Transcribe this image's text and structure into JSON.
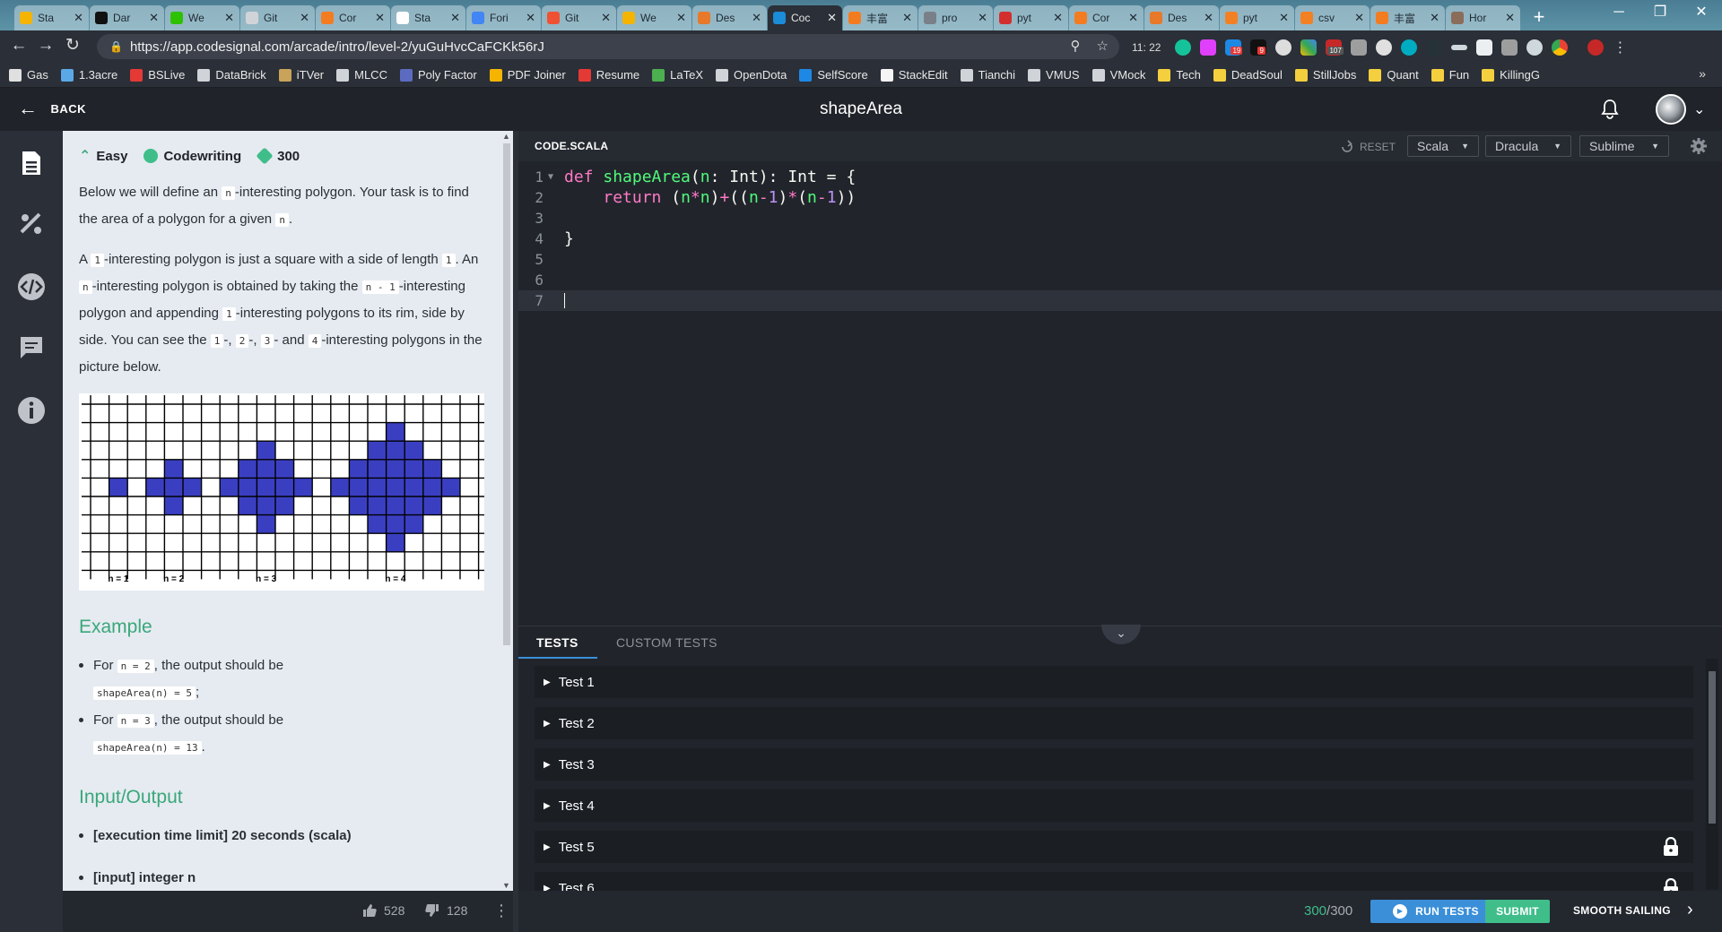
{
  "browser": {
    "tabs": [
      {
        "label": "Sta",
        "icon": "drive-icon",
        "color": "#f4b400",
        "active": false
      },
      {
        "label": "Dar",
        "icon": "github-icon",
        "color": "#111111",
        "active": false
      },
      {
        "label": "We",
        "icon": "wechat-icon",
        "color": "#2dc100",
        "active": false
      },
      {
        "label": "Git",
        "icon": "doc-icon",
        "color": "#d0d4d8",
        "active": false
      },
      {
        "label": "Cor",
        "icon": "orange-icon",
        "color": "#f47c20",
        "active": false
      },
      {
        "label": "Sta",
        "icon": "stack-icon",
        "color": "#ffffff",
        "active": false
      },
      {
        "label": "Fori",
        "icon": "google-icon",
        "color": "#4285f4",
        "active": false
      },
      {
        "label": "Git",
        "icon": "git-icon",
        "color": "#f05133",
        "active": false
      },
      {
        "label": "We",
        "icon": "drive-icon",
        "color": "#f4b400",
        "active": false
      },
      {
        "label": "Des",
        "icon": "bracket-icon",
        "color": "#e8782a",
        "active": false
      },
      {
        "label": "Coc",
        "icon": "codesignal-icon",
        "color": "#1a8cd8",
        "active": true
      },
      {
        "label": "丰富",
        "icon": "orange-icon",
        "color": "#f47c20",
        "active": false
      },
      {
        "label": "pro",
        "icon": "globe-icon",
        "color": "#7a8088",
        "active": false
      },
      {
        "label": "pyt",
        "icon": "c-icon",
        "color": "#d32f2f",
        "active": false
      },
      {
        "label": "Cor",
        "icon": "orange-icon",
        "color": "#f47c20",
        "active": false
      },
      {
        "label": "Des",
        "icon": "bracket-icon",
        "color": "#e8782a",
        "active": false
      },
      {
        "label": "pyt",
        "icon": "stack-icon",
        "color": "#f48024",
        "active": false
      },
      {
        "label": "csv",
        "icon": "stack-icon",
        "color": "#f48024",
        "active": false
      },
      {
        "label": "丰富",
        "icon": "orange-icon",
        "color": "#f47c20",
        "active": false
      },
      {
        "label": "Hor",
        "icon": "house-icon",
        "color": "#8a6d5b",
        "active": false
      }
    ],
    "address": {
      "url": "https://app.codesignal.com/arcade/intro/level-2/yuGuHvcCaFCKk56rJ",
      "time": "11: 22",
      "badges": {
        "b1": "19",
        "b2": "9",
        "b3": "107"
      }
    },
    "bookmarks": [
      {
        "label": "Gas",
        "color": "#e0e0e0"
      },
      {
        "label": "1.3acre",
        "color": "#5aa9e6"
      },
      {
        "label": "BSLive",
        "color": "#e53935"
      },
      {
        "label": "DataBrick",
        "color": "#d0d4d8"
      },
      {
        "label": "iTVer",
        "color": "#c9a35a"
      },
      {
        "label": "MLCC",
        "color": "#d0d4d8"
      },
      {
        "label": "Poly Factor",
        "color": "#5c6bc0"
      },
      {
        "label": "PDF Joiner",
        "color": "#f4b400"
      },
      {
        "label": "Resume",
        "color": "#e53935"
      },
      {
        "label": "LaTeX",
        "color": "#4caf50"
      },
      {
        "label": "OpenDota",
        "color": "#d0d4d8"
      },
      {
        "label": "SelfScore",
        "color": "#1e88e5"
      },
      {
        "label": "StackEdit",
        "color": "#f5f5f5"
      },
      {
        "label": "Tianchi",
        "color": "#d0d4d8"
      },
      {
        "label": "VMUS",
        "color": "#d0d4d8"
      },
      {
        "label": "VMock",
        "color": "#d0d4d8"
      },
      {
        "label": "Tech",
        "color": "#f4d03f"
      },
      {
        "label": "DeadSoul",
        "color": "#f4d03f"
      },
      {
        "label": "StillJobs",
        "color": "#f4d03f"
      },
      {
        "label": "Quant",
        "color": "#f4d03f"
      },
      {
        "label": "Fun",
        "color": "#f4d03f"
      },
      {
        "label": "KillingG",
        "color": "#f4d03f"
      }
    ],
    "more": "»"
  },
  "header": {
    "back_label": "BACK",
    "title": "shapeArea"
  },
  "description": {
    "difficulty": "Easy",
    "category": "Codewriting",
    "points": "300",
    "p1": {
      "a": "Below we will define an ",
      "c1": "n",
      "b": "-interesting polygon. Your task is to find the area of a polygon for a given ",
      "c2": "n",
      "d": "."
    },
    "p2": {
      "a": "A ",
      "c1": "1",
      "b": "-interesting polygon is just a square with a side of length ",
      "c2": "1",
      "c": ". An ",
      "c3": "n",
      "d": "-interesting polygon is obtained by taking the ",
      "c4": "n - 1",
      "e": "-interesting polygon and appending ",
      "c5": "1",
      "f": "-interesting polygons to its rim, side by side. You can see the ",
      "c6": "1",
      "g": "-, ",
      "c7": "2",
      "h": "-, ",
      "c8": "3",
      "i": "- and ",
      "c9": "4",
      "j": "-interesting polygons in the picture below."
    },
    "figure_labels": [
      "n = 1",
      "n = 2",
      "n = 3",
      "n = 4"
    ],
    "figure_color": "#3a3fc2",
    "example_heading": "Example",
    "examples": [
      {
        "pre": "For ",
        "input": "n = 2",
        "mid": ", the output should be",
        "output": "shapeArea(n) = 5",
        "end": ";"
      },
      {
        "pre": "For ",
        "input": "n = 3",
        "mid": ", the output should be",
        "output": "shapeArea(n) = 13",
        "end": "."
      }
    ],
    "io_heading": "Input/Output",
    "io_items": [
      "[execution time limit] 20 seconds (scala)",
      "[input] integer n"
    ]
  },
  "footer": {
    "likes": "528",
    "dislikes": "128"
  },
  "editor": {
    "file_name": "CODE.SCALA",
    "reset_label": "RESET",
    "language": "Scala",
    "theme": "Dracula",
    "keymap": "Sublime",
    "line_numbers": [
      "1",
      "2",
      "3",
      "4",
      "5",
      "6",
      "7"
    ],
    "code": {
      "l1": {
        "kw": "def",
        "sp": " ",
        "fn": "shapeArea",
        "a": "(",
        "p": "n",
        "b": ": ",
        "t1": "Int",
        "c": "): ",
        "t2": "Int",
        "d": " = {"
      },
      "l2": {
        "indent": "    ",
        "kw": "return",
        "a": " (",
        "n1": "n",
        "op1": "*",
        "n2": "n",
        "b": ")",
        "op2": "+",
        "c": "((",
        "n3": "n",
        "op3": "-",
        "one1": "1",
        "d": ")",
        "op4": "*",
        "e": "(",
        "n4": "n",
        "op5": "-",
        "one2": "1",
        "f": "))"
      },
      "l4": "}"
    }
  },
  "tests": {
    "tab_tests": "TESTS",
    "tab_custom": "CUSTOM TESTS",
    "rows": [
      "Test 1",
      "Test 2",
      "Test 3",
      "Test 4",
      "Test 5",
      "Test 6"
    ]
  },
  "bottom": {
    "score": "300",
    "total": "/300",
    "run_label": "RUN TESTS",
    "submit_label": "SUBMIT",
    "status_label": "SMOOTH SAILING"
  },
  "colors": {
    "accent_green": "#3fbe8a",
    "accent_blue": "#3a8fd8",
    "polygon": "#3a3fc2"
  }
}
